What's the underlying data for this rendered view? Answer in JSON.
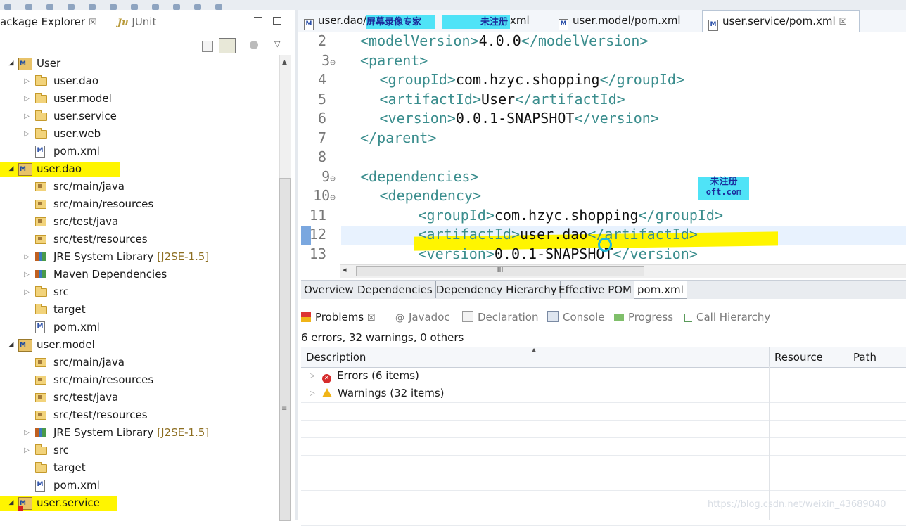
{
  "package_explorer": {
    "tab_label": "ackage Explorer",
    "close_glyph": "☒",
    "junit_prefix": "Ju",
    "junit_label": "JUnit"
  },
  "tree": [
    {
      "label": "User",
      "type": "project",
      "expanded": true
    },
    {
      "label": "user.dao",
      "type": "folder"
    },
    {
      "label": "user.model",
      "type": "folder"
    },
    {
      "label": "user.service",
      "type": "folder"
    },
    {
      "label": "user.web",
      "type": "folder"
    },
    {
      "label": "pom.xml",
      "type": "pom"
    },
    {
      "label": "user.dao",
      "type": "project",
      "expanded": true,
      "highlight": true
    },
    {
      "label": "src/main/java",
      "type": "srcfolder"
    },
    {
      "label": "src/main/resources",
      "type": "srcfolder"
    },
    {
      "label": "src/test/java",
      "type": "srcfolder"
    },
    {
      "label": "src/test/resources",
      "type": "srcfolder"
    },
    {
      "label": "JRE System Library",
      "suffix": "[J2SE-1.5]",
      "type": "library"
    },
    {
      "label": "Maven Dependencies",
      "type": "library"
    },
    {
      "label": "src",
      "type": "folder"
    },
    {
      "label": "target",
      "type": "folder-noarrow"
    },
    {
      "label": "pom.xml",
      "type": "pom"
    },
    {
      "label": "user.model",
      "type": "project",
      "expanded": true
    },
    {
      "label": "src/main/java",
      "type": "srcfolder"
    },
    {
      "label": "src/main/resources",
      "type": "srcfolder"
    },
    {
      "label": "src/test/java",
      "type": "srcfolder"
    },
    {
      "label": "src/test/resources",
      "type": "srcfolder"
    },
    {
      "label": "JRE System Library",
      "suffix": "[J2SE-1.5]",
      "type": "library"
    },
    {
      "label": "src",
      "type": "folder"
    },
    {
      "label": "target",
      "type": "folder-noarrow"
    },
    {
      "label": "pom.xml",
      "type": "pom"
    },
    {
      "label": "user.service",
      "type": "project",
      "expanded": true,
      "highlight": true,
      "error": true
    }
  ],
  "editor_tabs": [
    {
      "label": "user.dao/",
      "trail": "xml"
    },
    {
      "label": "user.model/pom.xml"
    },
    {
      "label": "user.service/pom.xml",
      "close": "☒",
      "active": true
    }
  ],
  "watermark": {
    "top_left": "屏幕录像专家",
    "top_right": "未注册",
    "mid_line1": "未注册",
    "mid_line2": "oft.com"
  },
  "code_lines": [
    {
      "num": "2",
      "indent": 0,
      "parts": [
        [
          "tag",
          "<modelVersion>"
        ],
        [
          "txt",
          "4.0.0"
        ],
        [
          "tag",
          "</modelVersion>"
        ]
      ]
    },
    {
      "num": "3",
      "fold": "⊖",
      "indent": 0,
      "parts": [
        [
          "tag",
          "<parent>"
        ]
      ]
    },
    {
      "num": "4",
      "indent": 1,
      "parts": [
        [
          "tag",
          "<groupId>"
        ],
        [
          "txt",
          "com.hzyc.shopping"
        ],
        [
          "tag",
          "</groupId>"
        ]
      ]
    },
    {
      "num": "5",
      "indent": 1,
      "parts": [
        [
          "tag",
          "<artifactId>"
        ],
        [
          "txt",
          "User"
        ],
        [
          "tag",
          "</artifactId>"
        ]
      ]
    },
    {
      "num": "6",
      "indent": 1,
      "parts": [
        [
          "tag",
          "<version>"
        ],
        [
          "txt",
          "0.0.1-SNAPSHOT"
        ],
        [
          "tag",
          "</version>"
        ]
      ]
    },
    {
      "num": "7",
      "indent": 0,
      "parts": [
        [
          "tag",
          "</parent>"
        ]
      ]
    },
    {
      "num": "8",
      "indent": 0,
      "parts": []
    },
    {
      "num": "9",
      "fold": "⊖",
      "indent": 0,
      "parts": [
        [
          "tag",
          "<dependencies>"
        ]
      ]
    },
    {
      "num": "10",
      "fold": "⊖",
      "indent": 1,
      "parts": [
        [
          "tag",
          "<dependency>"
        ]
      ]
    },
    {
      "num": "11",
      "indent": 3,
      "parts": [
        [
          "tag",
          "<groupId>"
        ],
        [
          "txt",
          "com.hzyc.shopping"
        ],
        [
          "tag",
          "</groupId>"
        ]
      ]
    },
    {
      "num": "12",
      "indent": 3,
      "parts": [
        [
          "tag",
          "<artifactId>"
        ],
        [
          "txt",
          "user.dao"
        ],
        [
          "tag",
          "</artifactId>"
        ]
      ]
    },
    {
      "num": "13",
      "indent": 3,
      "parts": [
        [
          "tag",
          "<version>"
        ],
        [
          "txt",
          "0.0.1-SNAPSHOT"
        ],
        [
          "tag",
          "</version>"
        ]
      ]
    }
  ],
  "hscroll_thumb": "III",
  "pom_tabs": [
    "Overview",
    "Dependencies",
    "Dependency Hierarchy",
    "Effective POM",
    "pom.xml"
  ],
  "problems": {
    "tabs": [
      {
        "label": "Problems",
        "close": "☒",
        "active": true
      },
      {
        "label": "Javadoc"
      },
      {
        "label": "Declaration"
      },
      {
        "label": "Console"
      },
      {
        "label": "Progress"
      },
      {
        "label": "Call Hierarchy"
      }
    ],
    "summary": "6 errors, 32 warnings, 0 others",
    "columns": [
      "Description",
      "Resource",
      "Path"
    ],
    "rows": [
      {
        "kind": "error",
        "label": "Errors (6 items)"
      },
      {
        "kind": "warning",
        "label": "Warnings (32 items)"
      }
    ]
  },
  "footer_url": "https://blog.csdn.net/weixin_43689040",
  "colors": {
    "xml_tag": "#3a8d8d",
    "highlight": "#fff500",
    "watermark_bg": "#4fe3f7"
  }
}
